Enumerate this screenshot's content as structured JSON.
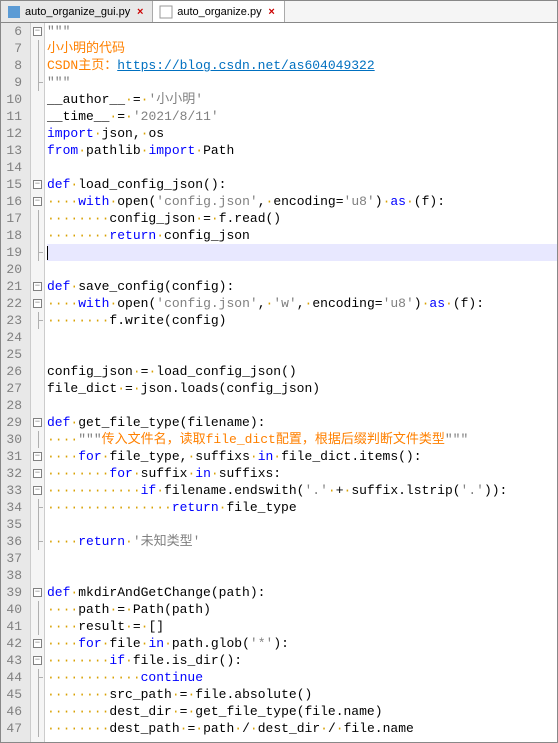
{
  "tabs": [
    {
      "label": "auto_organize_gui.py",
      "active": false,
      "icon": "blue"
    },
    {
      "label": "auto_organize.py",
      "active": true,
      "icon": "white"
    }
  ],
  "first_line_number": 6,
  "lines": [
    {
      "n": 6,
      "fold": "open",
      "html": "<span class='tripleq'>\"\"\"</span>"
    },
    {
      "n": 7,
      "fold": "bar",
      "html": "<span class='docstr'>小小明的代码</span>"
    },
    {
      "n": 8,
      "fold": "bar",
      "html": "<span class='docstr'>CSDN主页：</span><span class='docstr-link'>https://blog.csdn.net/as604049322</span>"
    },
    {
      "n": 9,
      "fold": "end",
      "html": "<span class='tripleq'>\"\"\"</span>"
    },
    {
      "n": 10,
      "fold": "",
      "html": "<span class='black'>__author__</span><span class='ws'>·</span><span class='black'>=</span><span class='ws'>·</span><span class='gray'>'小小明'</span>"
    },
    {
      "n": 11,
      "fold": "",
      "html": "<span class='black'>__time__</span><span class='ws'>·</span><span class='black'>=</span><span class='ws'>·</span><span class='gray'>'2021/8/11'</span>"
    },
    {
      "n": 12,
      "fold": "",
      "html": "<span class='kw'>import</span><span class='ws'>·</span><span class='black'>json,</span><span class='ws'>·</span><span class='black'>os</span>"
    },
    {
      "n": 13,
      "fold": "",
      "html": "<span class='kw'>from</span><span class='ws'>·</span><span class='black'>pathlib</span><span class='ws'>·</span><span class='kw'>import</span><span class='ws'>·</span><span class='black'>Path</span>"
    },
    {
      "n": 14,
      "fold": "",
      "html": ""
    },
    {
      "n": 15,
      "fold": "open",
      "html": "<span class='kw'>def</span><span class='ws'>·</span><span class='black'>load_config_json</span><span class='black'>():</span>"
    },
    {
      "n": 16,
      "fold": "open2",
      "html": "<span class='ws'>····</span><span class='kw'>with</span><span class='ws'>·</span><span class='black'>open(</span><span class='gray'>'config.json'</span><span class='black'>,</span><span class='ws'>·</span><span class='black'>encoding=</span><span class='gray'>'u8'</span><span class='black'>)</span><span class='ws'>·</span><span class='kw'>as</span><span class='ws'>·</span><span class='black'>(f):</span>"
    },
    {
      "n": 17,
      "fold": "bar",
      "html": "<span class='ws'>········</span><span class='black'>config_json</span><span class='ws'>·</span><span class='black'>=</span><span class='ws'>·</span><span class='black'>f.read()</span>"
    },
    {
      "n": 18,
      "fold": "bar",
      "html": "<span class='ws'>········</span><span class='kw'>return</span><span class='ws'>·</span><span class='black'>config_json</span>"
    },
    {
      "n": 19,
      "fold": "end",
      "html": "",
      "current": true
    },
    {
      "n": 20,
      "fold": "",
      "html": ""
    },
    {
      "n": 21,
      "fold": "open",
      "html": "<span class='kw'>def</span><span class='ws'>·</span><span class='black'>save_config</span><span class='black'>(config):</span>"
    },
    {
      "n": 22,
      "fold": "open2",
      "html": "<span class='ws'>····</span><span class='kw'>with</span><span class='ws'>·</span><span class='black'>open(</span><span class='gray'>'config.json'</span><span class='black'>,</span><span class='ws'>·</span><span class='gray'>'w'</span><span class='black'>,</span><span class='ws'>·</span><span class='black'>encoding=</span><span class='gray'>'u8'</span><span class='black'>)</span><span class='ws'>·</span><span class='kw'>as</span><span class='ws'>·</span><span class='black'>(f):</span>"
    },
    {
      "n": 23,
      "fold": "end",
      "html": "<span class='ws'>········</span><span class='black'>f.write(config)</span>"
    },
    {
      "n": 24,
      "fold": "",
      "html": ""
    },
    {
      "n": 25,
      "fold": "",
      "html": ""
    },
    {
      "n": 26,
      "fold": "",
      "html": "<span class='black'>config_json</span><span class='ws'>·</span><span class='black'>=</span><span class='ws'>·</span><span class='black'>load_config_json()</span>"
    },
    {
      "n": 27,
      "fold": "",
      "html": "<span class='black'>file_dict</span><span class='ws'>·</span><span class='black'>=</span><span class='ws'>·</span><span class='black'>json.loads(config_json)</span>"
    },
    {
      "n": 28,
      "fold": "",
      "html": ""
    },
    {
      "n": 29,
      "fold": "open",
      "html": "<span class='kw'>def</span><span class='ws'>·</span><span class='black'>get_file_type</span><span class='black'>(filename):</span>"
    },
    {
      "n": 30,
      "fold": "bar",
      "html": "<span class='ws'>····</span><span class='tripleq'>\"\"\"</span><span class='docstr'>传入文件名，读取file_dict配置，根据后缀判断文件类型</span><span class='tripleq'>\"\"\"</span>"
    },
    {
      "n": 31,
      "fold": "open2",
      "html": "<span class='ws'>····</span><span class='kw'>for</span><span class='ws'>·</span><span class='black'>file_type,</span><span class='ws'>·</span><span class='black'>suffixs</span><span class='ws'>·</span><span class='kw'>in</span><span class='ws'>·</span><span class='black'>file_dict.items():</span>"
    },
    {
      "n": 32,
      "fold": "open2",
      "html": "<span class='ws'>········</span><span class='kw'>for</span><span class='ws'>·</span><span class='black'>suffix</span><span class='ws'>·</span><span class='kw'>in</span><span class='ws'>·</span><span class='black'>suffixs:</span>"
    },
    {
      "n": 33,
      "fold": "open2",
      "html": "<span class='ws'>············</span><span class='kw'>if</span><span class='ws'>·</span><span class='black'>filename.endswith(</span><span class='gray'>'.'</span><span class='ws'>·</span><span class='black'>+</span><span class='ws'>·</span><span class='black'>suffix.lstrip(</span><span class='gray'>'.'</span><span class='black'>)):</span>"
    },
    {
      "n": 34,
      "fold": "end",
      "html": "<span class='ws'>················</span><span class='kw'>return</span><span class='ws'>·</span><span class='black'>file_type</span>"
    },
    {
      "n": 35,
      "fold": "bar",
      "html": ""
    },
    {
      "n": 36,
      "fold": "end",
      "html": "<span class='ws'>····</span><span class='kw'>return</span><span class='ws'>·</span><span class='gray'>'未知类型'</span>"
    },
    {
      "n": 37,
      "fold": "",
      "html": ""
    },
    {
      "n": 38,
      "fold": "",
      "html": ""
    },
    {
      "n": 39,
      "fold": "open",
      "html": "<span class='kw'>def</span><span class='ws'>·</span><span class='black'>mkdirAndGetChange</span><span class='black'>(path):</span>"
    },
    {
      "n": 40,
      "fold": "bar",
      "html": "<span class='ws'>····</span><span class='black'>path</span><span class='ws'>·</span><span class='black'>=</span><span class='ws'>·</span><span class='black'>Path(path)</span>"
    },
    {
      "n": 41,
      "fold": "bar",
      "html": "<span class='ws'>····</span><span class='black'>result</span><span class='ws'>·</span><span class='black'>=</span><span class='ws'>·</span><span class='black'>[]</span>"
    },
    {
      "n": 42,
      "fold": "open2",
      "html": "<span class='ws'>····</span><span class='kw'>for</span><span class='ws'>·</span><span class='black'>file</span><span class='ws'>·</span><span class='kw'>in</span><span class='ws'>·</span><span class='black'>path.glob(</span><span class='gray'>'*'</span><span class='black'>):</span>"
    },
    {
      "n": 43,
      "fold": "open2",
      "html": "<span class='ws'>········</span><span class='kw'>if</span><span class='ws'>·</span><span class='black'>file.is_dir():</span>"
    },
    {
      "n": 44,
      "fold": "end",
      "html": "<span class='ws'>············</span><span class='kw'>continue</span>"
    },
    {
      "n": 45,
      "fold": "bar",
      "html": "<span class='ws'>········</span><span class='black'>src_path</span><span class='ws'>·</span><span class='black'>=</span><span class='ws'>·</span><span class='black'>file.absolute()</span>"
    },
    {
      "n": 46,
      "fold": "bar",
      "html": "<span class='ws'>········</span><span class='black'>dest_dir</span><span class='ws'>·</span><span class='black'>=</span><span class='ws'>·</span><span class='black'>get_file_type(file.name)</span>"
    },
    {
      "n": 47,
      "fold": "bar",
      "html": "<span class='ws'>········</span><span class='black'>dest_path</span><span class='ws'>·</span><span class='black'>=</span><span class='ws'>·</span><span class='black'>path</span><span class='ws'>·</span><span class='black'>/</span><span class='ws'>·</span><span class='black'>dest_dir</span><span class='ws'>·</span><span class='black'>/</span><span class='ws'>·</span><span class='black'>file.name</span>"
    }
  ]
}
